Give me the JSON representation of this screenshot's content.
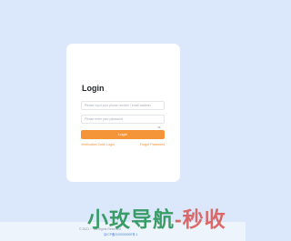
{
  "login": {
    "title": "Login",
    "account_placeholder": "Please input your phone number / email address",
    "password_placeholder": "Please enter your password",
    "login_button": "Login",
    "verification_link": "Verification Code Login",
    "forgot_link": "Forgot Password"
  },
  "footer": {
    "copyright": "© 2021 ··· All Rights Reserved",
    "icp": "京ICP备2020000000号-1"
  },
  "watermark": {
    "part1": "小玫导航",
    "part2": "-秒收"
  },
  "colors": {
    "accent": "#f5953a",
    "background": "#dbe8fb",
    "card": "#ffffff",
    "link": "#f0913a"
  },
  "icons": {
    "password_toggle": "eye-icon"
  }
}
